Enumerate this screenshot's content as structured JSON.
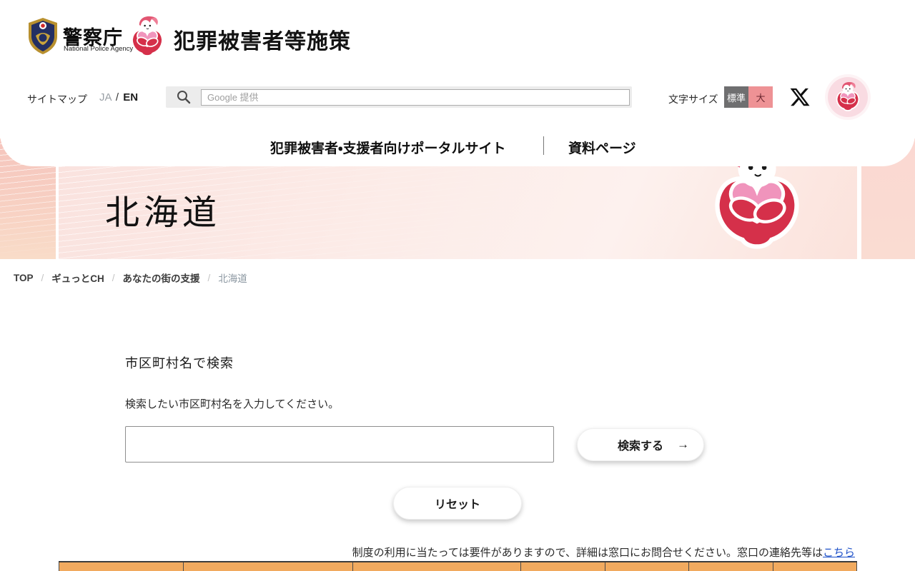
{
  "header": {
    "agency": {
      "name_jp": "警察庁",
      "name_en": "National Police Agency"
    },
    "site_title": "犯罪被害者等施策",
    "utility": {
      "sitemap": "サイトマップ",
      "lang_current": "JA",
      "lang_divider": "/",
      "lang_alt": "EN",
      "search_placeholder": "Google 提供",
      "font_size_label": "文字サイズ",
      "font_size_options": [
        {
          "label": "標準"
        },
        {
          "label": "大"
        }
      ]
    },
    "nav": [
      {
        "label": "犯罪被害者・支援者向けポータルサイト"
      },
      {
        "label": "資料ページ"
      }
    ]
  },
  "hero": {
    "prefecture": "北海道"
  },
  "breadcrumb": {
    "separator": "/",
    "items": [
      {
        "label": "TOP"
      },
      {
        "label": "ギュっとCH"
      },
      {
        "label": "あなたの街の支援"
      },
      {
        "label": "北海道"
      }
    ]
  },
  "search_section": {
    "heading": "市区町村名で検索",
    "instruction": "検索したい市区町村名を入力してください。",
    "input_value": "",
    "search_button": "検索する",
    "search_button_arrow": "→",
    "reset_button": "リセット"
  },
  "notice": {
    "text_before_link": "制度の利用に当たっては要件がありますので、詳細は窓口にお問合せください。窓口の連絡先等は",
    "link_label": "こちら"
  },
  "table": {
    "column_count": 7
  },
  "icons": {
    "search": "magnifier",
    "x_social": "x-logo",
    "police_badge": "shield-emblem",
    "mascot": "gyutto-chan-heart-mascot"
  },
  "colors": {
    "mascot_red": "#d5304a",
    "heart_pink": "#f094bc",
    "table_header_orange": "#f1aa5f",
    "font_btn_standard_bg": "#6f6f70",
    "font_btn_large_bg": "#ee9295",
    "link_blue": "#1d50c8"
  }
}
